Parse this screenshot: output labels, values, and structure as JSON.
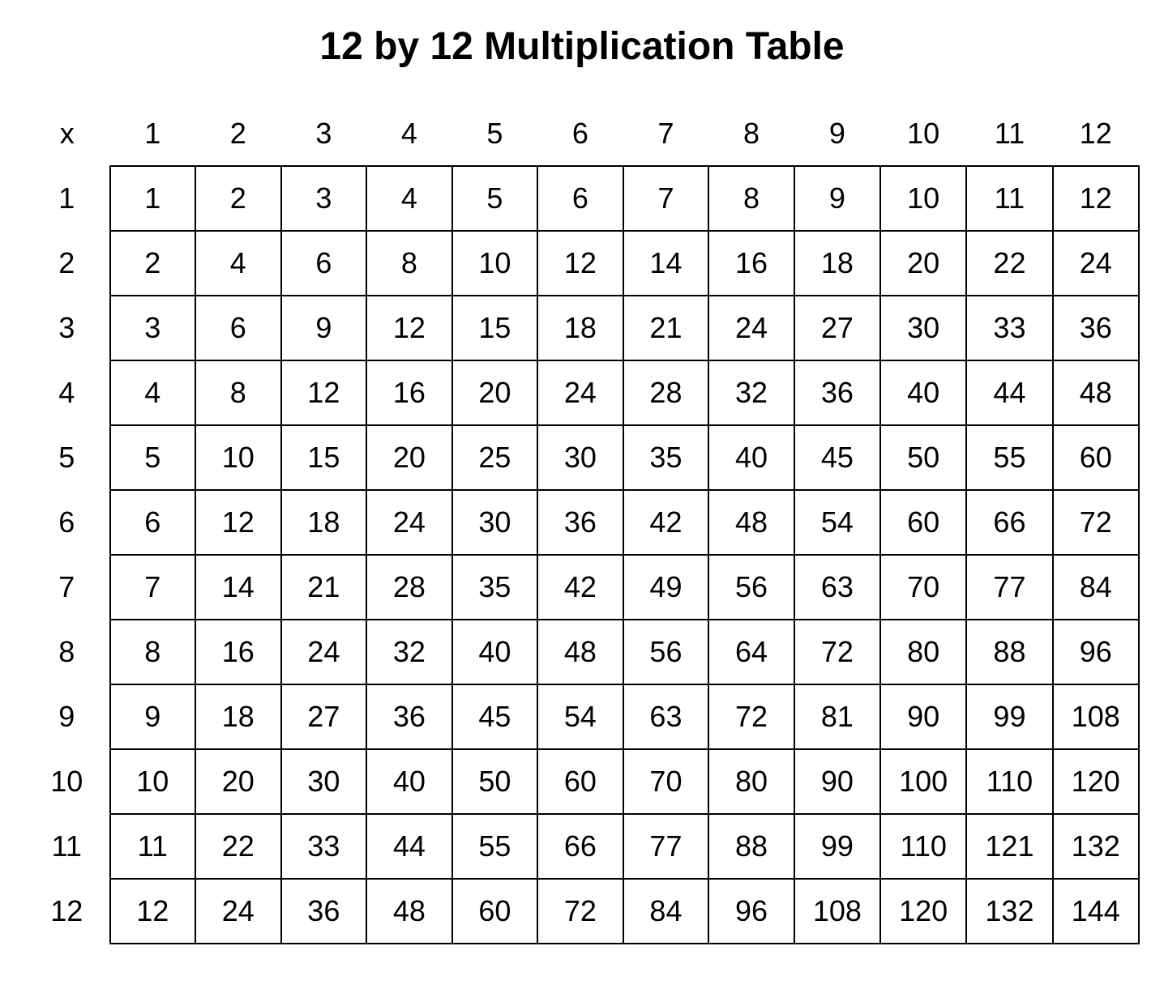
{
  "title": "12 by 12 Multiplication Table",
  "corner_label": "x",
  "col_headers": [
    "1",
    "2",
    "3",
    "4",
    "5",
    "6",
    "7",
    "8",
    "9",
    "10",
    "11",
    "12"
  ],
  "row_headers": [
    "1",
    "2",
    "3",
    "4",
    "5",
    "6",
    "7",
    "8",
    "9",
    "10",
    "11",
    "12"
  ],
  "rows": [
    [
      "1",
      "2",
      "3",
      "4",
      "5",
      "6",
      "7",
      "8",
      "9",
      "10",
      "11",
      "12"
    ],
    [
      "2",
      "4",
      "6",
      "8",
      "10",
      "12",
      "14",
      "16",
      "18",
      "20",
      "22",
      "24"
    ],
    [
      "3",
      "6",
      "9",
      "12",
      "15",
      "18",
      "21",
      "24",
      "27",
      "30",
      "33",
      "36"
    ],
    [
      "4",
      "8",
      "12",
      "16",
      "20",
      "24",
      "28",
      "32",
      "36",
      "40",
      "44",
      "48"
    ],
    [
      "5",
      "10",
      "15",
      "20",
      "25",
      "30",
      "35",
      "40",
      "45",
      "50",
      "55",
      "60"
    ],
    [
      "6",
      "12",
      "18",
      "24",
      "30",
      "36",
      "42",
      "48",
      "54",
      "60",
      "66",
      "72"
    ],
    [
      "7",
      "14",
      "21",
      "28",
      "35",
      "42",
      "49",
      "56",
      "63",
      "70",
      "77",
      "84"
    ],
    [
      "8",
      "16",
      "24",
      "32",
      "40",
      "48",
      "56",
      "64",
      "72",
      "80",
      "88",
      "96"
    ],
    [
      "9",
      "18",
      "27",
      "36",
      "45",
      "54",
      "63",
      "72",
      "81",
      "90",
      "99",
      "108"
    ],
    [
      "10",
      "20",
      "30",
      "40",
      "50",
      "60",
      "70",
      "80",
      "90",
      "100",
      "110",
      "120"
    ],
    [
      "11",
      "22",
      "33",
      "44",
      "55",
      "66",
      "77",
      "88",
      "99",
      "110",
      "121",
      "132"
    ],
    [
      "12",
      "24",
      "36",
      "48",
      "60",
      "72",
      "84",
      "96",
      "108",
      "120",
      "132",
      "144"
    ]
  ],
  "chart_data": {
    "type": "table",
    "title": "12 by 12 Multiplication Table",
    "columns": [
      1,
      2,
      3,
      4,
      5,
      6,
      7,
      8,
      9,
      10,
      11,
      12
    ],
    "rows_index": [
      1,
      2,
      3,
      4,
      5,
      6,
      7,
      8,
      9,
      10,
      11,
      12
    ],
    "values": [
      [
        1,
        2,
        3,
        4,
        5,
        6,
        7,
        8,
        9,
        10,
        11,
        12
      ],
      [
        2,
        4,
        6,
        8,
        10,
        12,
        14,
        16,
        18,
        20,
        22,
        24
      ],
      [
        3,
        6,
        9,
        12,
        15,
        18,
        21,
        24,
        27,
        30,
        33,
        36
      ],
      [
        4,
        8,
        12,
        16,
        20,
        24,
        28,
        32,
        36,
        40,
        44,
        48
      ],
      [
        5,
        10,
        15,
        20,
        25,
        30,
        35,
        40,
        45,
        50,
        55,
        60
      ],
      [
        6,
        12,
        18,
        24,
        30,
        36,
        42,
        48,
        54,
        60,
        66,
        72
      ],
      [
        7,
        14,
        21,
        28,
        35,
        42,
        49,
        56,
        63,
        70,
        77,
        84
      ],
      [
        8,
        16,
        24,
        32,
        40,
        48,
        56,
        64,
        72,
        80,
        88,
        96
      ],
      [
        9,
        18,
        27,
        36,
        45,
        54,
        63,
        72,
        81,
        90,
        99,
        108
      ],
      [
        10,
        20,
        30,
        40,
        50,
        60,
        70,
        80,
        90,
        100,
        110,
        120
      ],
      [
        11,
        22,
        33,
        44,
        55,
        66,
        77,
        88,
        99,
        110,
        121,
        132
      ],
      [
        12,
        24,
        36,
        48,
        60,
        72,
        84,
        96,
        108,
        120,
        132,
        144
      ]
    ]
  }
}
